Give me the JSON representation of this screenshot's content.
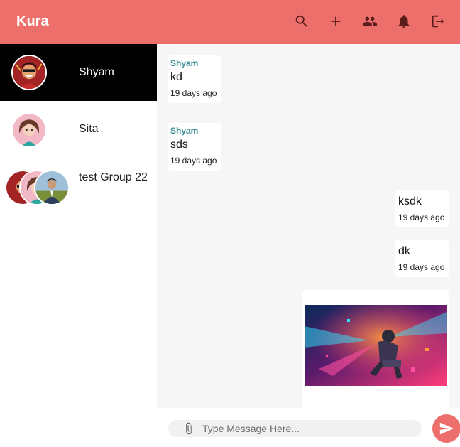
{
  "app": {
    "title": "Kura"
  },
  "header": {
    "icons": [
      "search-icon",
      "add-icon",
      "people-icon",
      "bell-icon",
      "logout-icon"
    ],
    "accent_color": "#ec6f6c"
  },
  "sidebar": {
    "conversations": [
      {
        "name": "Shyam",
        "active": true
      },
      {
        "name": "Sita",
        "active": false
      },
      {
        "name": "test Group 22",
        "active": false
      }
    ]
  },
  "messages": [
    {
      "sender": "Shyam",
      "text": "kd",
      "time": "19 days ago",
      "direction": "incoming"
    },
    {
      "sender": "Shyam",
      "text": "sds",
      "time": "19 days ago",
      "direction": "incoming"
    },
    {
      "sender": "",
      "text": "ksdk",
      "time": "19 days ago",
      "direction": "outgoing"
    },
    {
      "sender": "",
      "text": "dk",
      "time": "19 days ago",
      "direction": "outgoing"
    },
    {
      "sender": "",
      "text": "",
      "time": "",
      "direction": "outgoing",
      "type": "image"
    }
  ],
  "composer": {
    "placeholder": "Type Message Here...",
    "value": "",
    "attach_icon": "paperclip-icon",
    "send_icon": "send-icon"
  }
}
